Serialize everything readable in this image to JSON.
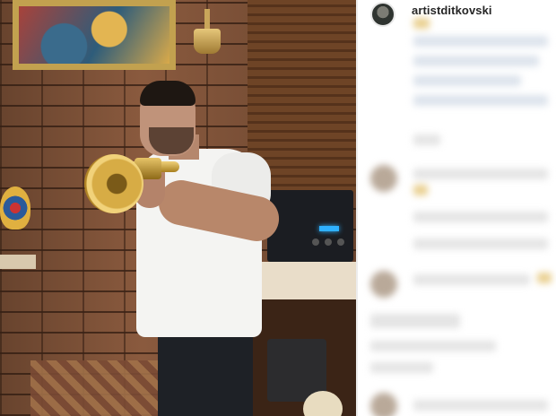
{
  "post": {
    "username": "artistditkovski"
  },
  "colors": {
    "panel_bg": "#ffffff",
    "username_text": "#262626"
  },
  "icons": {
    "avatar": "profile-avatar"
  }
}
